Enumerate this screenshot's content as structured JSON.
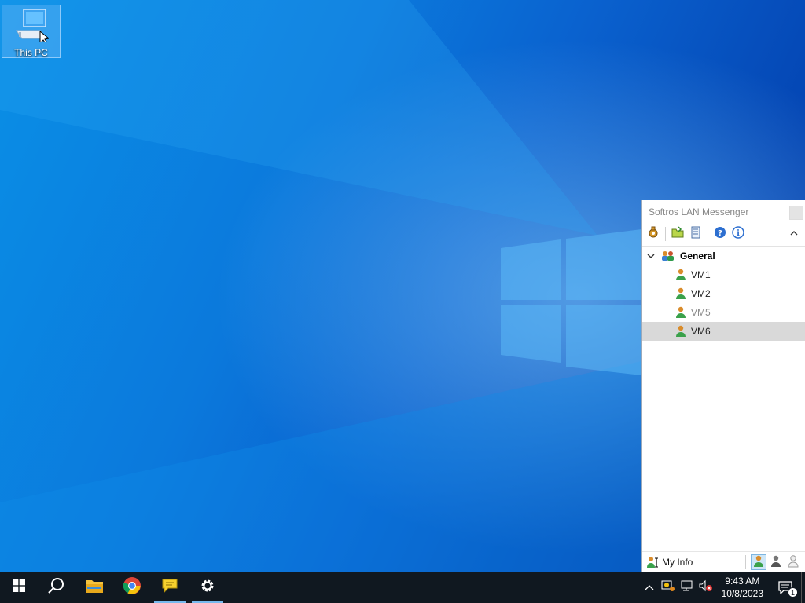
{
  "desktop": {
    "icons": [
      {
        "label": "This PC",
        "icon": "computer-icon"
      }
    ]
  },
  "messenger": {
    "title": "Softros LAN Messenger",
    "toolbar": [
      "settings-icon",
      "open-folder-icon",
      "message-history-icon",
      "help-icon",
      "info-icon",
      "collapse-icon"
    ],
    "group": {
      "label": "General",
      "expanded": true
    },
    "users": [
      {
        "label": "VM1",
        "status": "online"
      },
      {
        "label": "VM2",
        "status": "online"
      },
      {
        "label": "VM5",
        "status": "offline"
      },
      {
        "label": "VM6",
        "status": "online",
        "selected": true
      }
    ],
    "status_bar": {
      "my_info_label": "My Info",
      "status_buttons": [
        "status-online-icon",
        "status-away-icon",
        "status-offline-icon"
      ]
    }
  },
  "taskbar": {
    "apps": [
      "start-icon",
      "search-icon",
      "file-explorer-icon",
      "chrome-icon",
      "softros-messenger-icon",
      "settings-icon"
    ],
    "clock": {
      "time": "9:43 AM",
      "date": "10/8/2023"
    },
    "notification_count": "1"
  },
  "colors": {
    "taskbar": "#101820",
    "selection": "#d9d9d9",
    "accent": "#76b9ed"
  }
}
